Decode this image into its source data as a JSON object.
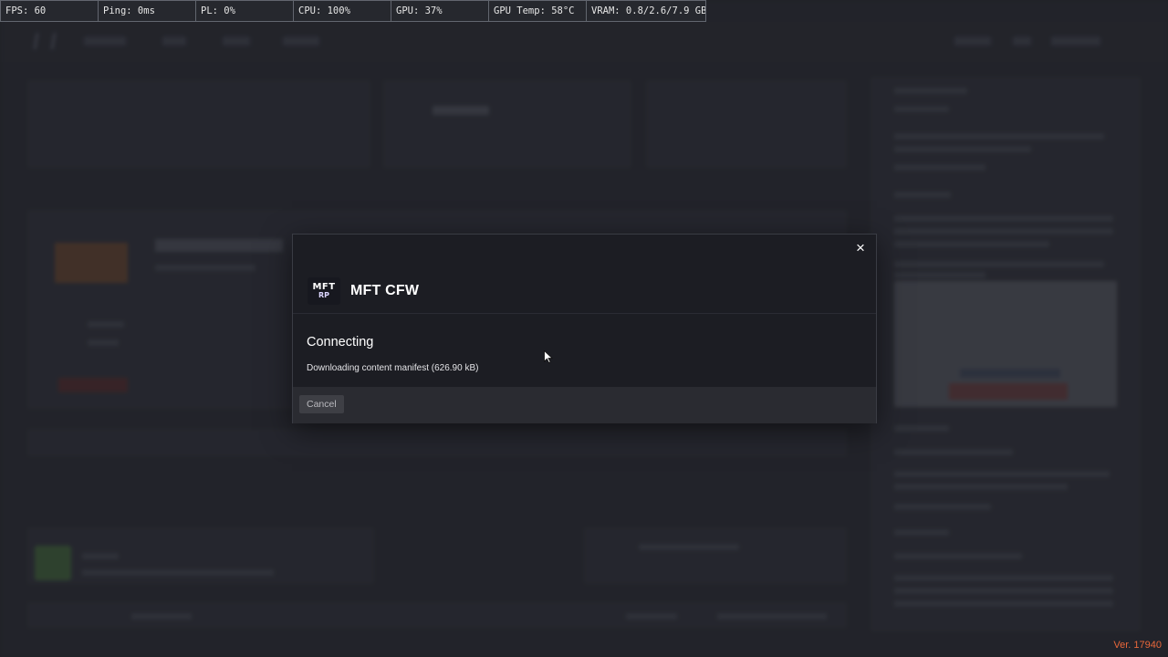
{
  "stats": [
    {
      "label": "FPS: 60",
      "w": 107
    },
    {
      "label": "Ping: 0ms",
      "w": 107
    },
    {
      "label": "PL: 0%",
      "w": 107
    },
    {
      "label": "CPU: 100%",
      "w": 107
    },
    {
      "label": "GPU: 37%",
      "w": 107
    },
    {
      "label": "GPU Temp: 58°C",
      "w": 107
    },
    {
      "label": "VRAM: 0.8/2.6/7.9 GB",
      "w": 130
    }
  ],
  "modal": {
    "server_logo_line1": "MFT",
    "server_logo_line2": "RP",
    "server_name": "MFT CFW",
    "status_title": "Connecting",
    "status_detail": "Downloading content manifest (626.90 kB)",
    "cancel_label": "Cancel",
    "close_glyph": "×"
  },
  "version": "Ver. 17940",
  "colors": {
    "accent": "#e8673a",
    "modal_bg": "#1c1d23",
    "footer_bg": "#2a2b31"
  }
}
